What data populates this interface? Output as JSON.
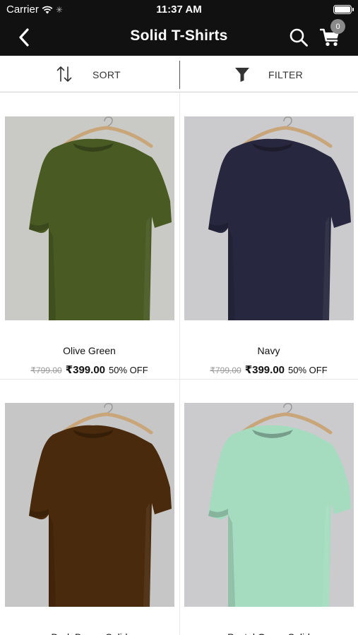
{
  "status_bar": {
    "carrier": "Carrier",
    "time": "11:37 AM"
  },
  "nav": {
    "title": "Solid T-Shirts",
    "cart_count": "0"
  },
  "toolbar": {
    "sort_label": "SORT",
    "filter_label": "FILTER"
  },
  "products": [
    {
      "name": "Olive Green",
      "mrp": "₹799.00",
      "price": "₹399.00",
      "discount": "50% OFF",
      "color": "#495a23",
      "background": "#c9cac5"
    },
    {
      "name": "Navy",
      "mrp": "₹799.00",
      "price": "₹399.00",
      "discount": "50% OFF",
      "color": "#27283f",
      "background": "#cbcacd"
    },
    {
      "name": "Dark Brown Solid",
      "color": "#4a2a0c",
      "background": "#c6c6c6"
    },
    {
      "name": "Pastel Green Solid",
      "color": "#a5dcc0",
      "background": "#cbcbcd"
    }
  ]
}
